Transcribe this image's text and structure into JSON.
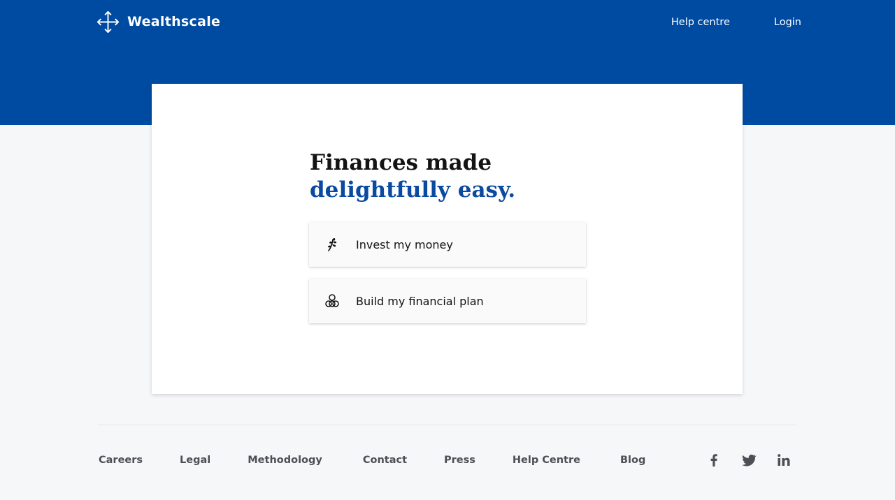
{
  "header": {
    "brand_name": "Wealthscale",
    "brand_icon": "four-arrows-icon",
    "nav": [
      {
        "label": "Help centre"
      },
      {
        "label": "Login"
      }
    ],
    "background_color": "#004ba2"
  },
  "main": {
    "headline_line1": "Finances made",
    "headline_line2": "delightfully easy.",
    "accent_color": "#0a4aa0",
    "options": [
      {
        "label": "Invest my money",
        "icon": "sprout-icon"
      },
      {
        "label": "Build my financial plan",
        "icon": "stacked-coins-icon"
      }
    ]
  },
  "footer": {
    "links": [
      "Careers",
      "Legal",
      "Methodology",
      "Contact",
      "Press",
      "Help Centre",
      "Blog"
    ],
    "social": [
      "facebook-icon",
      "twitter-icon",
      "linkedin-icon"
    ]
  }
}
